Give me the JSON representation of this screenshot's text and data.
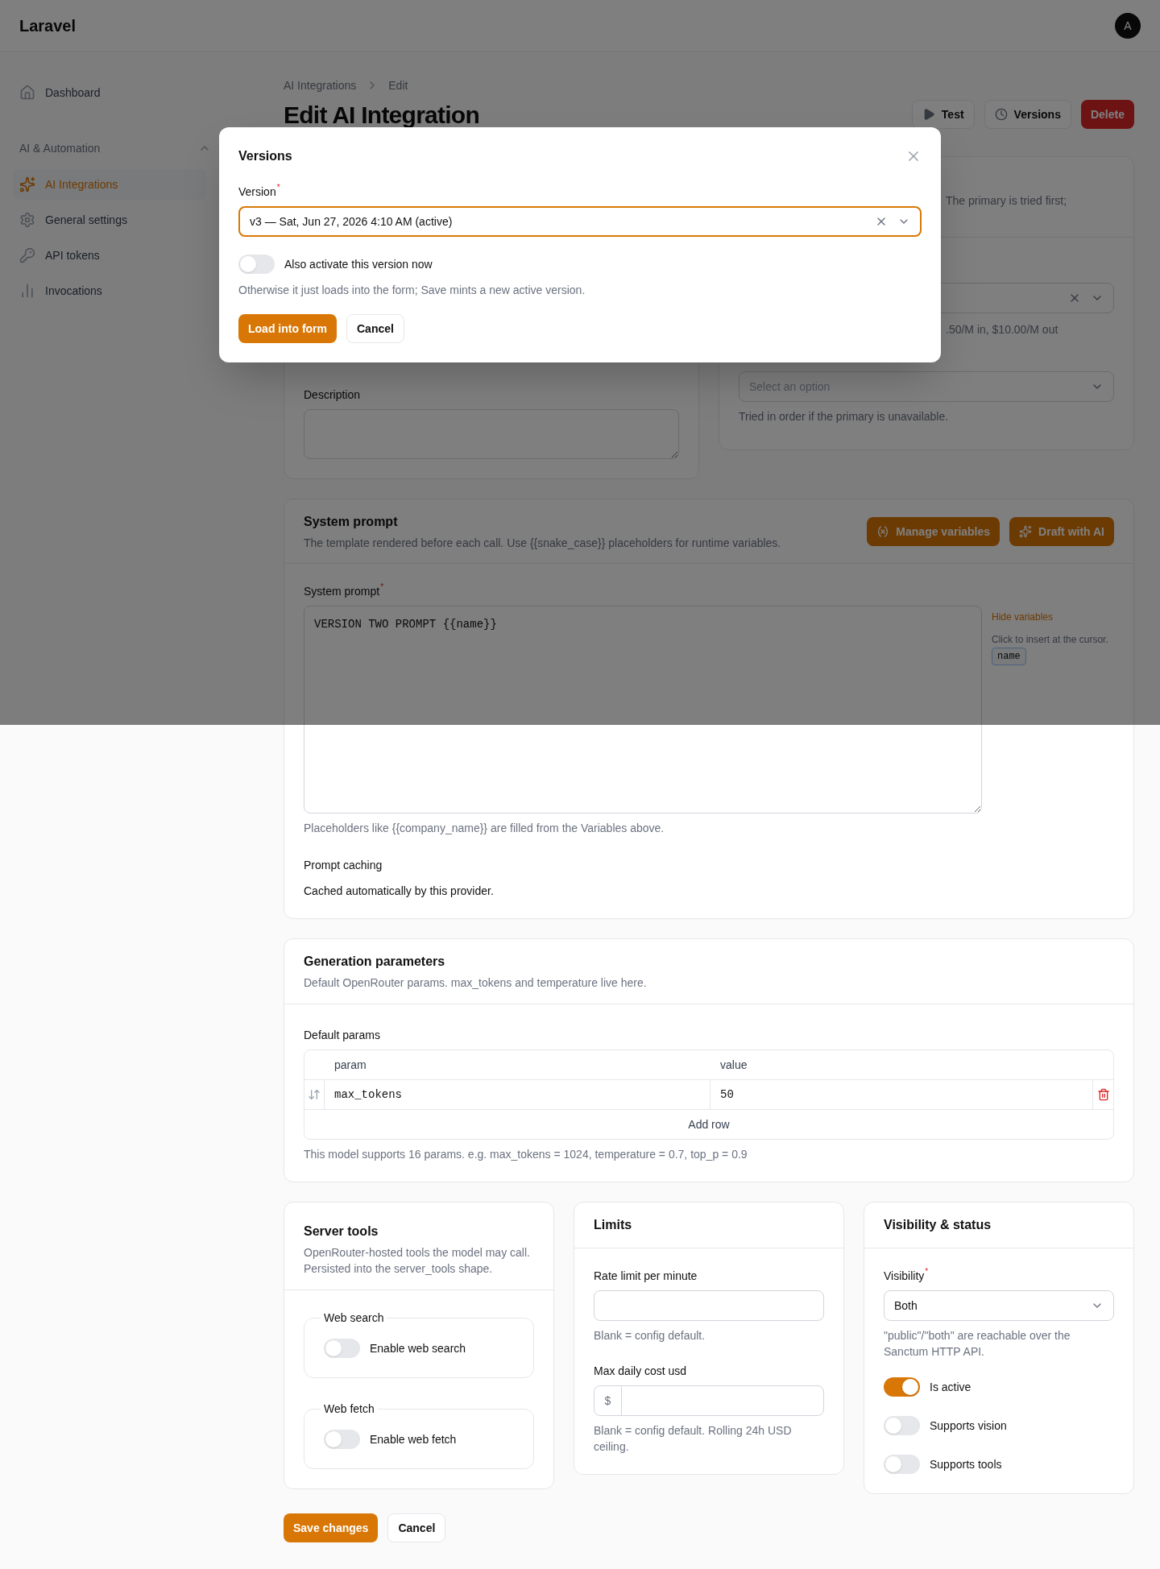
{
  "header": {
    "brand": "Laravel",
    "avatar": "A"
  },
  "sidebar": {
    "items": [
      {
        "label": "Dashboard",
        "kind": "home",
        "selected": false
      }
    ],
    "groups": [
      {
        "title": "AI & Automation",
        "expanded": true,
        "items": [
          {
            "label": "AI Integrations",
            "kind": "sparkles",
            "selected": true
          },
          {
            "label": "General settings",
            "kind": "gear",
            "selected": false
          },
          {
            "label": "API tokens",
            "kind": "key",
            "selected": false
          },
          {
            "label": "Invocations",
            "kind": "chart",
            "selected": false
          }
        ]
      }
    ]
  },
  "breadcrumb": [
    "AI Integrations",
    "Edit"
  ],
  "page_title": "Edit AI Integration",
  "actions": [
    {
      "label": "Test",
      "kind": "play"
    },
    {
      "label": "Versions",
      "kind": "clock"
    },
    {
      "label": "Delete",
      "kind": "danger"
    }
  ],
  "details_card": {
    "description_label": "Description"
  },
  "models_card": {
    "description_fragment": "The primary is tried first;",
    "pricing_fragment": ".50/M in, $10.00/M out",
    "fallback_placeholder": "Select an option",
    "fallback_hint": "Tried in order if the primary is unavailable."
  },
  "system_prompt": {
    "title": "System prompt",
    "description": "The template rendered before each call. Use {{snake_case}} placeholders for runtime variables.",
    "buttons": [
      {
        "label": "Manage variables",
        "kind": "variable"
      },
      {
        "label": "Draft with AI",
        "kind": "sparkles"
      }
    ],
    "field_label": "System prompt",
    "required_mark": "*",
    "value": "VERSION TWO PROMPT {{name}}",
    "variables_toggle": "Hide variables",
    "variables_hint": "Click to insert at the cursor.",
    "variables": [
      "name"
    ],
    "hint": "Placeholders like {{company_name}} are filled from the Variables above.",
    "caching_label": "Prompt caching",
    "caching_text": "Cached automatically by this provider."
  },
  "generation": {
    "title": "Generation parameters",
    "description": "Default OpenRouter params. max_tokens and temperature live here.",
    "table_label": "Default params",
    "columns": [
      "param",
      "value"
    ],
    "rows": [
      {
        "param": "max_tokens",
        "value": "50"
      }
    ],
    "add_row": "Add row",
    "hint": "This model supports 16 params. e.g. max_tokens = 1024, temperature = 0.7, top_p = 0.9"
  },
  "server_tools": {
    "title": "Server tools",
    "description": "OpenRouter-hosted tools the model may call. Persisted into the server_tools shape.",
    "groups": [
      {
        "legend": "Web search",
        "label": "Enable web search",
        "on": false
      },
      {
        "legend": "Web fetch",
        "label": "Enable web fetch",
        "on": false
      }
    ]
  },
  "limits": {
    "title": "Limits",
    "fields": [
      {
        "label": "Rate limit per minute",
        "hint": "Blank = config default."
      },
      {
        "label": "Max daily cost usd",
        "prefix": "$",
        "hint": "Blank = config default. Rolling 24h USD ceiling."
      }
    ]
  },
  "visibility": {
    "title": "Visibility & status",
    "label": "Visibility",
    "required_mark": "*",
    "value": "Both",
    "hint": "\"public\"/\"both\" are reachable over the Sanctum HTTP API.",
    "toggles": [
      {
        "label": "Is active",
        "on": true
      },
      {
        "label": "Supports vision",
        "on": false
      },
      {
        "label": "Supports tools",
        "on": false
      }
    ]
  },
  "footer": [
    {
      "label": "Save changes",
      "kind": "primary"
    },
    {
      "label": "Cancel",
      "kind": "secondary"
    }
  ],
  "modal": {
    "title": "Versions",
    "label": "Version",
    "required_mark": "*",
    "value": "v3 — Sat, Jun 27, 2026 4:10 AM (active)",
    "activate": {
      "label": "Also activate this version now",
      "on": false
    },
    "hint": "Otherwise it just loads into the form; Save mints a new active version.",
    "buttons": [
      {
        "label": "Load into form",
        "kind": "primary"
      },
      {
        "label": "Cancel",
        "kind": "secondary"
      }
    ]
  }
}
